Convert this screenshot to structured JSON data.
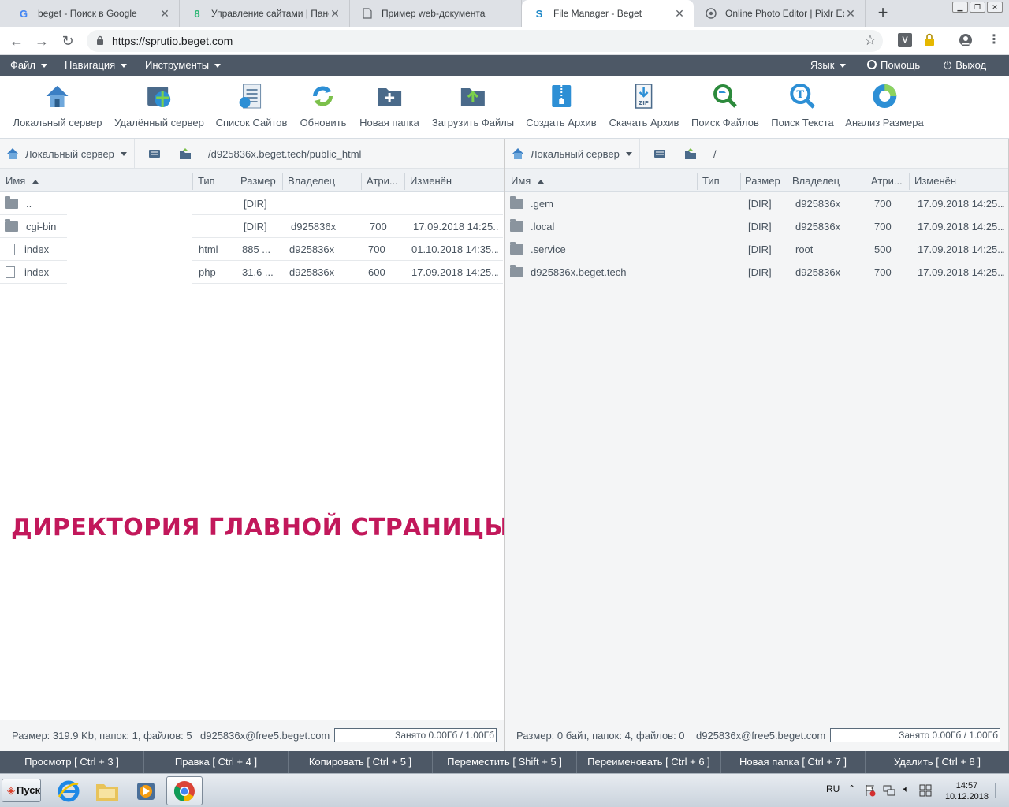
{
  "browser": {
    "tabs": [
      {
        "title": "beget - Поиск в Google",
        "favicon": "google-g-icon"
      },
      {
        "title": "Управление сайтами | Панель",
        "favicon": "beget-icon"
      },
      {
        "title": "Пример web-документа",
        "favicon": "document-icon"
      },
      {
        "title": "File Manager - Beget",
        "favicon": "beget-icon",
        "active": true
      },
      {
        "title": "Online Photo Editor | Pixlr Editor",
        "favicon": "pixlr-icon"
      }
    ],
    "url": "https://sprutio.beget.com",
    "ext_v": "V"
  },
  "menubar": {
    "file": "Файл",
    "navigation": "Навигация",
    "tools": "Инструменты",
    "language": "Язык",
    "help": "Помощь",
    "exit": "Выход"
  },
  "toolbar": {
    "local_server": "Локальный сервер",
    "remote_server": "Удалённый сервер",
    "sites_list": "Список Сайтов",
    "refresh": "Обновить",
    "new_folder": "Новая папка",
    "upload": "Загрузить Файлы",
    "create_archive": "Создать Архив",
    "download_archive": "Скачать Архив",
    "search_files": "Поиск Файлов",
    "search_text": "Поиск Текста",
    "size_analysis": "Анализ Размера",
    "zip_label": "ZIP"
  },
  "columns": {
    "name": "Имя",
    "type": "Тип",
    "size": "Размер",
    "owner": "Владелец",
    "attrs": "Атри...",
    "modified": "Изменён"
  },
  "left_panel": {
    "server": "Локальный сервер",
    "path": "/d925836x.beget.tech/public_html",
    "rows": [
      {
        "name": "..",
        "type": "",
        "size": "[DIR]",
        "owner": "",
        "attrs": "",
        "modified": ""
      },
      {
        "name": "cgi-bin",
        "type": "",
        "size": "[DIR]",
        "owner": "d925836x",
        "attrs": "700",
        "modified": "17.09.2018 14:25..."
      },
      {
        "name": "index",
        "type": "html",
        "size": "885 ...",
        "owner": "d925836x",
        "attrs": "700",
        "modified": "01.10.2018 14:35..."
      },
      {
        "name": "index",
        "type": "php",
        "size": "31.6 ...",
        "owner": "d925836x",
        "attrs": "600",
        "modified": "17.09.2018 14:25..."
      }
    ],
    "annotation": "ДИРЕКТОРИЯ ГЛАВНОЙ СТРАНИЦЫ",
    "status_size": "Размер: 319.9 Kb, папок: 1, файлов: 5",
    "status_user": "d925836x@free5.beget.com",
    "quota": "Занято 0.00Гб / 1.00Гб"
  },
  "right_panel": {
    "server": "Локальный сервер",
    "path": "/",
    "rows": [
      {
        "name": ".gem",
        "type": "",
        "size": "[DIR]",
        "owner": "d925836x",
        "attrs": "700",
        "modified": "17.09.2018 14:25..."
      },
      {
        "name": ".local",
        "type": "",
        "size": "[DIR]",
        "owner": "d925836x",
        "attrs": "700",
        "modified": "17.09.2018 14:25..."
      },
      {
        "name": ".service",
        "type": "",
        "size": "[DIR]",
        "owner": "root",
        "attrs": "500",
        "modified": "17.09.2018 14:25..."
      },
      {
        "name": "d925836x.beget.tech",
        "type": "",
        "size": "[DIR]",
        "owner": "d925836x",
        "attrs": "700",
        "modified": "17.09.2018 14:25..."
      }
    ],
    "status_size": "Размер: 0 байт, папок: 4, файлов: 0",
    "status_user": "d925836x@free5.beget.com",
    "quota": "Занято 0.00Гб / 1.00Гб"
  },
  "actions": [
    "Просмотр [ Ctrl + 3 ]",
    "Правка [ Ctrl + 4 ]",
    "Копировать [ Ctrl + 5 ]",
    "Переместить [ Shift + 5 ]",
    "Переименовать [ Ctrl + 6 ]",
    "Новая папка [ Ctrl + 7 ]",
    "Удалить [ Ctrl + 8 ]"
  ],
  "taskbar": {
    "start": "Пуск",
    "lang": "RU",
    "time": "14:57",
    "date": "10.12.2018"
  },
  "colors": {
    "menubar": "#4d5866",
    "annotation": "#c2185b",
    "icon_blue": "#2d8fd5"
  }
}
